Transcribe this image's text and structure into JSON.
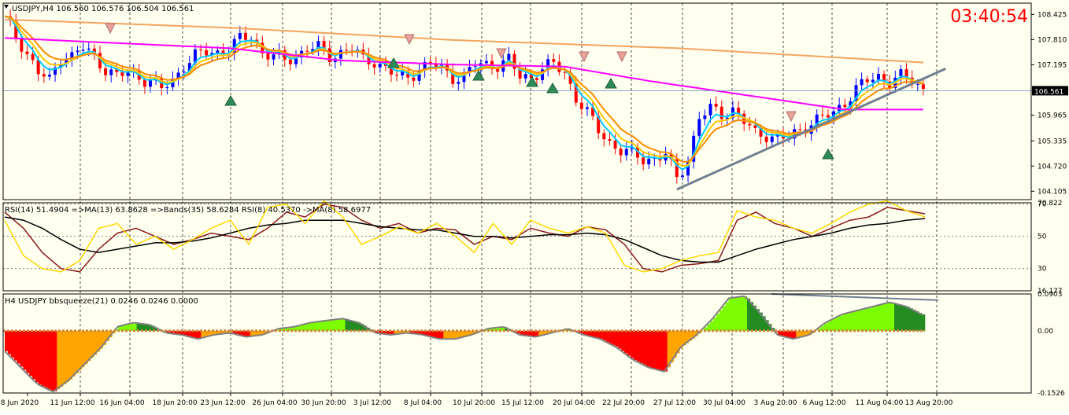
{
  "colors": {
    "background": "#fffff0",
    "axis": "#000000",
    "grid": "#000000",
    "bull_candle": "#0000ff",
    "bear_candle": "#ff0000",
    "ma_fast": "#00c8ff",
    "ma_mid1": "#ffc800",
    "ma_mid2": "#ff8c00",
    "ma_magenta": "#ff00ff",
    "ma_slow": "#f4a460",
    "trendline": "#708090",
    "clock": "#ff0000",
    "rsi_main": "#8b1a1a",
    "rsi_signal": "#000000",
    "rsi_fast": "#ffd700",
    "squeeze_pos_dark": "#228b22",
    "squeeze_pos_light": "#7cfc00",
    "squeeze_neg_dark": "#ff0000",
    "squeeze_neg_light": "#ffa500",
    "squeeze_line": "#808080"
  },
  "clock": "03:40:54",
  "main": {
    "header": "USDJPY,H4  106.560 106.576 106.504 106.561",
    "current_price_label": "106.561",
    "price_ticks": [
      "108.425",
      "107.810",
      "107.195",
      "105.965",
      "105.335",
      "104.720",
      "104.105"
    ]
  },
  "rsi_panel": {
    "header": "RSI(14) 51.4904  =>MA(13) 63.8628  =>Bands(35) 58.6284  RSI(8) 40.5370  ->MA(8) 58.6977",
    "ticks": [
      "70.822",
      "70",
      "50",
      "30",
      "16.177"
    ]
  },
  "squeeze_panel": {
    "header": "H4 USDJPY bbsqueeze(21) 0.0246 0.0246 0.0000",
    "ticks": [
      "0.0903",
      "0.00",
      "-0.1526"
    ]
  },
  "time_axis": [
    "8 Jun 2020",
    "11 Jun 12:00",
    "16 Jun 04:00",
    "18 Jun 20:00",
    "23 Jun 12:00",
    "26 Jun 04:00",
    "30 Jun 20:00",
    "3 Jul 12:00",
    "8 Jul 04:00",
    "10 Jul 20:00",
    "15 Jul 12:00",
    "20 Jul 04:00",
    "22 Jul 20:00",
    "27 Jul 12:00",
    "30 Jul 04:00",
    "3 Aug 20:00",
    "6 Aug 12:00",
    "11 Aug 04:00",
    "13 Aug 20:00"
  ],
  "chart_data": [
    {
      "type": "candlestick",
      "symbol": "USDJPY",
      "timeframe": "H4",
      "ohlc_current": {
        "open": 106.56,
        "high": 106.576,
        "low": 106.504,
        "close": 106.561
      },
      "ylim": [
        103.9,
        108.7
      ],
      "close_path": [
        [
          0,
          108.3
        ],
        [
          3,
          107.7
        ],
        [
          6,
          107.0
        ],
        [
          8,
          106.8
        ],
        [
          10,
          107.4
        ],
        [
          12,
          107.4
        ],
        [
          14,
          107.6
        ],
        [
          16,
          107.4
        ],
        [
          18,
          107.1
        ],
        [
          20,
          106.9
        ],
        [
          22,
          107.0
        ],
        [
          24,
          106.9
        ],
        [
          26,
          106.8
        ],
        [
          28,
          106.6
        ],
        [
          30,
          106.8
        ],
        [
          32,
          107.2
        ],
        [
          34,
          107.4
        ],
        [
          36,
          107.5
        ],
        [
          38,
          107.5
        ],
        [
          40,
          107.6
        ],
        [
          42,
          107.8
        ],
        [
          44,
          107.9
        ],
        [
          46,
          107.5
        ],
        [
          48,
          107.4
        ],
        [
          50,
          107.3
        ],
        [
          52,
          107.4
        ],
        [
          54,
          107.6
        ],
        [
          56,
          107.6
        ],
        [
          58,
          107.4
        ],
        [
          60,
          107.5
        ],
        [
          62,
          107.6
        ],
        [
          64,
          107.3
        ],
        [
          66,
          107.3
        ],
        [
          68,
          107.1
        ],
        [
          70,
          106.9
        ],
        [
          72,
          106.9
        ],
        [
          74,
          107.1
        ],
        [
          76,
          107.2
        ],
        [
          78,
          107.1
        ],
        [
          80,
          106.9
        ],
        [
          82,
          106.9
        ],
        [
          84,
          107.2
        ],
        [
          86,
          107.2
        ],
        [
          88,
          107.2
        ],
        [
          90,
          107.3
        ],
        [
          92,
          106.9
        ],
        [
          94,
          106.9
        ],
        [
          96,
          107.1
        ],
        [
          98,
          107.2
        ],
        [
          100,
          107.0
        ],
        [
          102,
          106.4
        ],
        [
          104,
          106.0
        ],
        [
          106,
          105.6
        ],
        [
          108,
          105.3
        ],
        [
          110,
          105.1
        ],
        [
          112,
          105.0
        ],
        [
          114,
          104.9
        ],
        [
          116,
          104.9
        ],
        [
          118,
          105.0
        ],
        [
          120,
          104.4
        ],
        [
          122,
          104.9
        ],
        [
          124,
          105.9
        ],
        [
          126,
          106.1
        ],
        [
          128,
          106.0
        ],
        [
          130,
          106.1
        ],
        [
          132,
          105.8
        ],
        [
          134,
          105.5
        ],
        [
          136,
          105.5
        ],
        [
          138,
          105.4
        ],
        [
          140,
          105.4
        ],
        [
          142,
          105.6
        ],
        [
          144,
          105.8
        ],
        [
          146,
          105.9
        ],
        [
          148,
          106.0
        ],
        [
          150,
          106.3
        ],
        [
          152,
          106.6
        ],
        [
          154,
          106.8
        ],
        [
          156,
          106.9
        ],
        [
          158,
          106.8
        ],
        [
          160,
          106.9
        ],
        [
          162,
          106.8
        ],
        [
          164,
          106.6
        ]
      ],
      "bars_total": 165,
      "moving_averages": [
        {
          "color_key": "ma_slow",
          "values": [
            [
              0,
              108.3
            ],
            [
              40,
              108.1
            ],
            [
              80,
              107.8
            ],
            [
              120,
              107.6
            ],
            [
              164,
              107.25
            ]
          ]
        },
        {
          "color_key": "ma_magenta",
          "values": [
            [
              0,
              107.85
            ],
            [
              40,
              107.6
            ],
            [
              60,
              107.3
            ],
            [
              80,
              107.2
            ],
            [
              100,
              107.15
            ],
            [
              115,
              106.8
            ],
            [
              130,
              106.5
            ],
            [
              150,
              106.1
            ],
            [
              164,
              106.1
            ]
          ]
        }
      ],
      "trendline": {
        "from": [
          120,
          104.15
        ],
        "to": [
          168,
          107.1
        ]
      },
      "current_price": 106.561
    },
    {
      "type": "line",
      "panel": "RSI(14)",
      "ylim": [
        16.177,
        70.822
      ],
      "levels": [
        70,
        50,
        30
      ],
      "series": [
        {
          "color_key": "rsi_main",
          "values": [
            65,
            55,
            40,
            30,
            28,
            42,
            52,
            55,
            50,
            45,
            48,
            52,
            50,
            48,
            55,
            65,
            62,
            70,
            68,
            60,
            55,
            58,
            52,
            55,
            54,
            45,
            50,
            48,
            55,
            52,
            50,
            56,
            54,
            45,
            30,
            28,
            32,
            33,
            35,
            60,
            65,
            58,
            55,
            50,
            55,
            60,
            62,
            68,
            66,
            64
          ]
        },
        {
          "color_key": "rsi_signal",
          "values": [
            62,
            60,
            55,
            48,
            42,
            40,
            42,
            44,
            46,
            46,
            47,
            49,
            52,
            55,
            57,
            58,
            60,
            60,
            60,
            58,
            56,
            55,
            54,
            54,
            52,
            50,
            50,
            49,
            50,
            51,
            51,
            52,
            51,
            48,
            43,
            38,
            35,
            34,
            34,
            38,
            42,
            45,
            48,
            50,
            52,
            55,
            57,
            58,
            60,
            61
          ]
        },
        {
          "color_key": "rsi_fast",
          "values": [
            60,
            38,
            30,
            28,
            35,
            55,
            58,
            45,
            50,
            42,
            48,
            55,
            60,
            45,
            68,
            70,
            58,
            72,
            62,
            45,
            50,
            56,
            52,
            58,
            50,
            40,
            58,
            45,
            60,
            55,
            52,
            56,
            52,
            32,
            28,
            30,
            35,
            38,
            40,
            66,
            62,
            60,
            55,
            52,
            58,
            65,
            70,
            72,
            66,
            62
          ]
        }
      ]
    },
    {
      "type": "bar",
      "panel": "bbsqueeze(21)",
      "ylim": [
        -0.1526,
        0.0903
      ],
      "values": [
        -0.05,
        -0.09,
        -0.13,
        -0.15,
        -0.12,
        -0.08,
        -0.04,
        0.01,
        0.02,
        0.015,
        -0.005,
        -0.01,
        -0.02,
        -0.01,
        -0.005,
        -0.015,
        -0.01,
        0.005,
        0.01,
        0.02,
        0.025,
        0.03,
        0.02,
        -0.005,
        -0.01,
        -0.005,
        -0.01,
        -0.02,
        -0.02,
        -0.01,
        0.005,
        0.01,
        -0.01,
        -0.015,
        -0.005,
        0.005,
        -0.01,
        -0.02,
        -0.04,
        -0.07,
        -0.09,
        -0.1,
        -0.04,
        -0.01,
        0.03,
        0.08,
        0.085,
        0.04,
        -0.01,
        -0.02,
        -0.01,
        0.02,
        0.04,
        0.05,
        0.06,
        0.07,
        0.06,
        0.04
      ]
    }
  ]
}
